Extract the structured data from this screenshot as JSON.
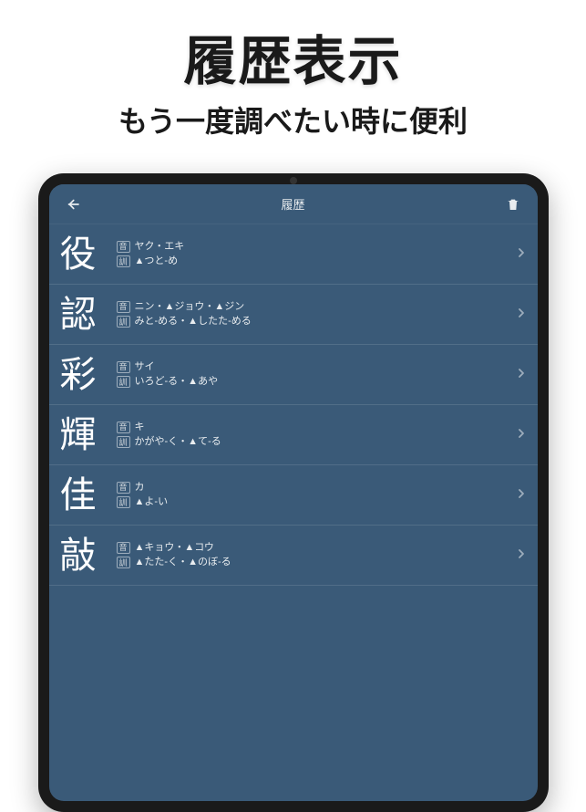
{
  "promo": {
    "title": "履歴表示",
    "subtitle": "もう一度調べたい時に便利"
  },
  "header": {
    "title": "履歴"
  },
  "labels": {
    "on": "音",
    "kun": "訓"
  },
  "entries": [
    {
      "kanji": "役",
      "on": "ヤク・エキ",
      "kun": "▲つと-め"
    },
    {
      "kanji": "認",
      "on": "ニン・▲ジョウ・▲ジン",
      "kun": "みと-める・▲したた-める"
    },
    {
      "kanji": "彩",
      "on": "サイ",
      "kun": "いろど-る・▲あや"
    },
    {
      "kanji": "輝",
      "on": "キ",
      "kun": "かがや-く・▲て-る"
    },
    {
      "kanji": "佳",
      "on": "カ",
      "kun": "▲よ-い"
    },
    {
      "kanji": "敲",
      "on": "▲キョウ・▲コウ",
      "kun": "▲たた-く・▲のぼ-る"
    }
  ]
}
